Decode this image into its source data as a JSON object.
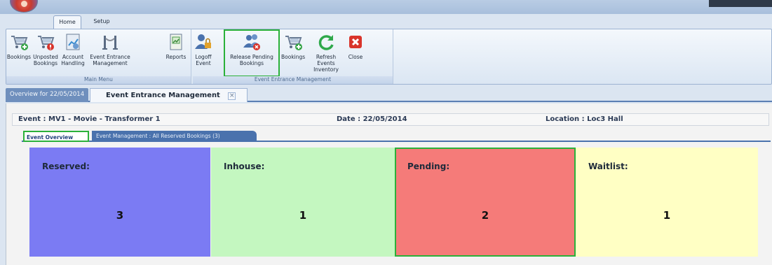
{
  "app": {
    "tabs": [
      "Home",
      "Setup"
    ]
  },
  "ribbon": {
    "main_menu": {
      "caption": "Main Menu",
      "buttons": [
        {
          "label": "Bookings",
          "icon": "cart-add-icon"
        },
        {
          "label": "Unposted Bookings",
          "icon": "cart-alert-icon"
        },
        {
          "label": "Account Handling",
          "icon": "account-chart-icon"
        },
        {
          "label": "Event Entrance Management",
          "icon": "rope-barrier-icon"
        },
        {
          "label": "Reports",
          "icon": "report-chart-icon"
        }
      ]
    },
    "event_entrance": {
      "caption": "Event Entrance Management",
      "buttons": [
        {
          "label": "Logoff Event",
          "icon": "user-lock-icon"
        },
        {
          "label": "Release Pending Bookings",
          "icon": "users-remove-icon"
        },
        {
          "label": "Bookings",
          "icon": "cart-add-icon"
        },
        {
          "label": "Refresh Events Inventory",
          "icon": "refresh-icon"
        },
        {
          "label": "Close",
          "icon": "close-icon"
        }
      ]
    }
  },
  "doc_tabs": {
    "overview": "Overview for 22/05/2014",
    "entrance": "Event Entrance Management",
    "close": "×"
  },
  "info": {
    "event": "Event : MV1  -  Movie - Transformer 1",
    "date": "Date : 22/05/2014",
    "location": "Location : Loc3  Hall"
  },
  "sub_tabs": {
    "overview": "Event Overview",
    "management": "Event Management : All Reserved Bookings (3)"
  },
  "cards": [
    {
      "label": "Reserved:",
      "value": "3",
      "color": "#7b7bf3"
    },
    {
      "label": "Inhouse:",
      "value": "1",
      "color": "#c4f7c0"
    },
    {
      "label": "Pending:",
      "value": "2",
      "color": "#f57b79"
    },
    {
      "label": "Waitlist:",
      "value": "1",
      "color": "#ffffc4"
    }
  ],
  "colors": {
    "highlight": "#2bb13a",
    "accent": "#4a72ad"
  }
}
